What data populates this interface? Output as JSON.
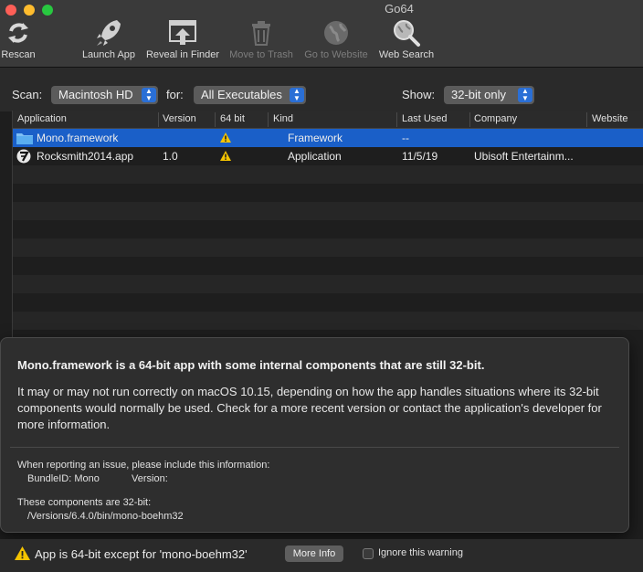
{
  "window": {
    "title": "Go64"
  },
  "toolbar": {
    "rescan": "Rescan",
    "launch": "Launch App",
    "reveal": "Reveal in Finder",
    "trash": "Move to Trash",
    "website": "Go to Website",
    "websearch": "Web Search"
  },
  "scan": {
    "scan_label": "Scan:",
    "scan_value": "Macintosh HD",
    "for_label": "for:",
    "for_value": "All Executables",
    "show_label": "Show:",
    "show_value": "32-bit only"
  },
  "table": {
    "headers": [
      "Application",
      "Version",
      "64 bit",
      "Kind",
      "Last Used",
      "Company",
      "Website"
    ],
    "rows": [
      {
        "name": "Mono.framework",
        "version": "",
        "kind": "Framework",
        "last_used": "--",
        "company": "",
        "selected": true
      },
      {
        "name": "Rocksmith2014.app",
        "version": "1.0",
        "kind": "Application",
        "last_used": "11/5/19",
        "company": "Ubisoft Entertainm...",
        "selected": false
      }
    ]
  },
  "popover": {
    "title": "Mono.framework is a 64-bit app with some internal components that are still 32-bit.",
    "body": "It may or may not run correctly on macOS 10.15, depending on how the app handles situations where its 32-bit components would normally be used. Check for a more recent version or contact the application's developer for more information.",
    "report_heading": "When reporting an issue, please include this information:",
    "bundle_id": "BundleID: Mono",
    "version_label": "Version:",
    "components_heading": "These components are 32-bit:",
    "component_path": "/Versions/6.4.0/bin/mono-boehm32"
  },
  "status": {
    "message": "App is 64-bit except for 'mono-boehm32'",
    "more_info": "More Info",
    "ignore": "Ignore this warning"
  },
  "colors": {
    "selection": "#1a5fc8",
    "warning": "#f5c400",
    "accent": "#2a6fd6"
  }
}
